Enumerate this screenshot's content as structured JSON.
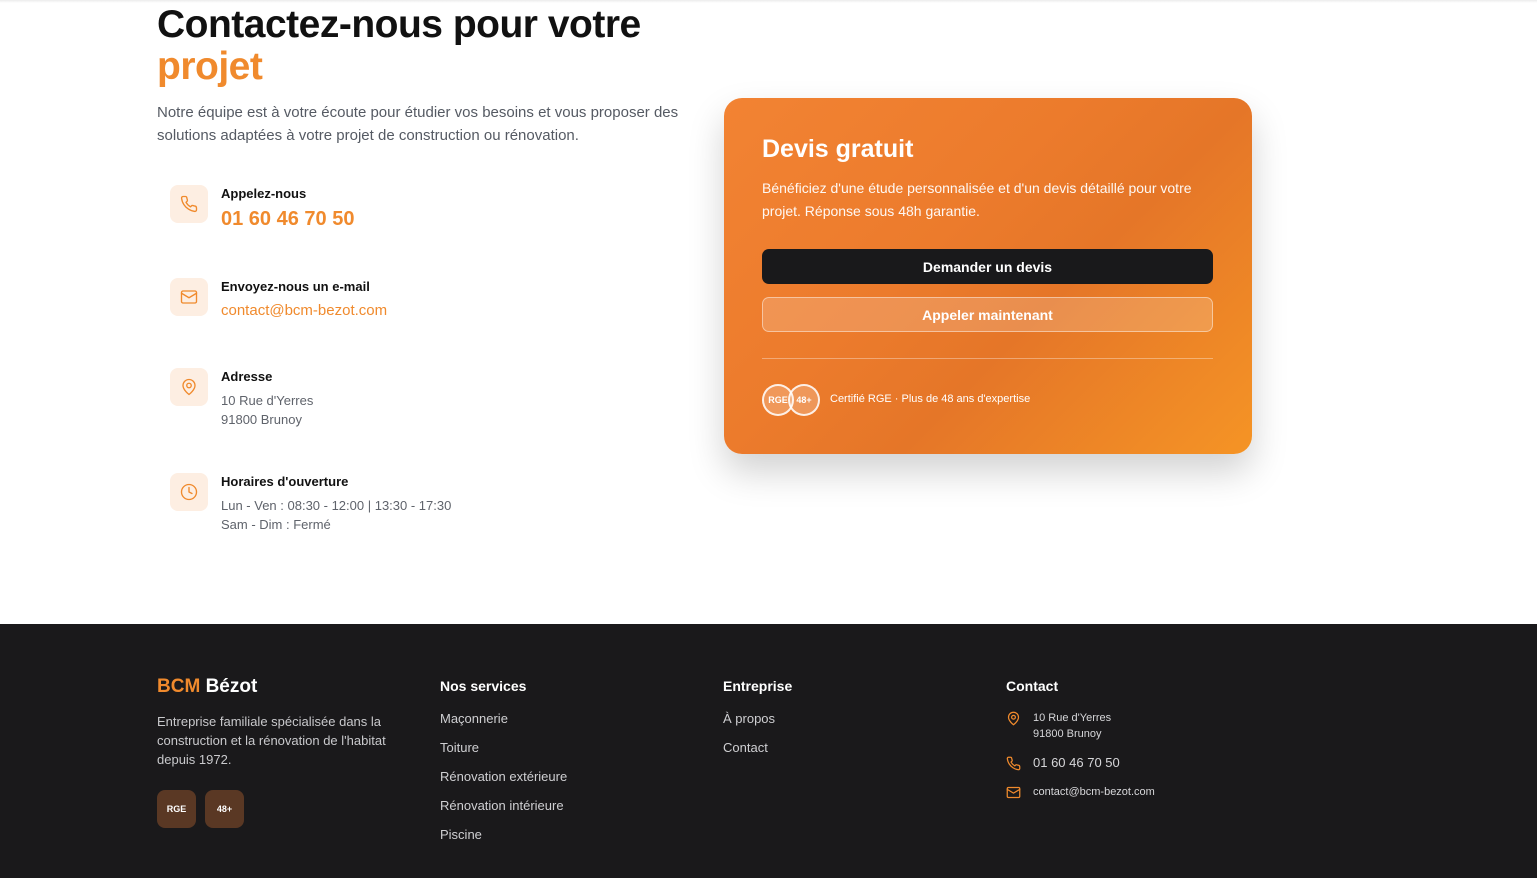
{
  "contact": {
    "title_line1": "Contactez-nous pour votre",
    "title_line2": "projet",
    "intro": "Notre équipe est à votre écoute pour étudier vos besoins et vous proposer des solutions adaptées à votre projet de construction ou rénovation.",
    "phone": {
      "label": "Appelez-nous",
      "value": "01 60 46 70 50",
      "icon": "phone-icon"
    },
    "email": {
      "label": "Envoyez-nous un e-mail",
      "value": "contact@bcm-bezot.com",
      "icon": "mail-icon"
    },
    "address": {
      "label": "Adresse",
      "line1": "10 Rue d'Yerres",
      "line2": "91800 Brunoy",
      "icon": "map-pin-icon"
    },
    "hours": {
      "label": "Horaires d'ouverture",
      "line1": "Lun - Ven : 08:30 - 12:00 | 13:30 - 17:30",
      "line2": "Sam - Dim : Fermé",
      "icon": "clock-icon"
    }
  },
  "quote_card": {
    "title": "Devis gratuit",
    "description": "Bénéficiez d'une étude personnalisée et d'un devis détaillé pour votre projet. Réponse sous 48h garantie.",
    "primary_button": "Demander un devis",
    "secondary_button": "Appeler maintenant",
    "badge1": "RGE",
    "badge2": "48+",
    "certification": "Certifié RGE · Plus de 48 ans d'expertise"
  },
  "footer": {
    "brand_accent": "BCM",
    "brand_name": "Bézot",
    "description": "Entreprise familiale spécialisée dans la construction et la rénovation de l'habitat depuis 1972.",
    "badge1": "RGE",
    "badge2": "48+",
    "services": {
      "heading": "Nos services",
      "items": [
        "Maçonnerie",
        "Toiture",
        "Rénovation extérieure",
        "Rénovation intérieure",
        "Piscine"
      ]
    },
    "company": {
      "heading": "Entreprise",
      "items": [
        "À propos",
        "Contact"
      ]
    },
    "contact": {
      "heading": "Contact",
      "address_line1": "10 Rue d'Yerres",
      "address_line2": "91800 Brunoy",
      "phone": "01 60 46 70 50",
      "email": "contact@bcm-bezot.com"
    }
  },
  "colors": {
    "accent": "#f08a2d",
    "dark": "#1a191b",
    "button_dark": "#19191b"
  }
}
